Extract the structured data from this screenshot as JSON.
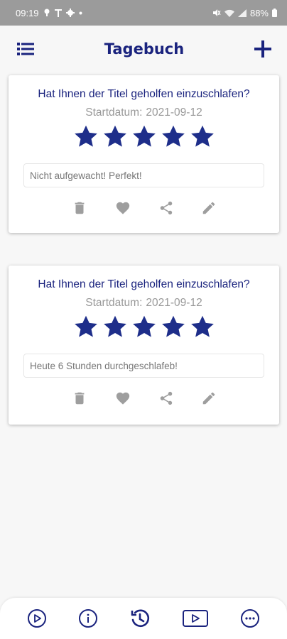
{
  "status_bar": {
    "time": "09:19",
    "battery": "88%",
    "left_icons": [
      "notification-dot-icon",
      "t-icon",
      "gear-icon",
      "dot-icon"
    ],
    "right_icons": [
      "mute-icon",
      "wifi-icon",
      "signal-icon",
      "battery-icon"
    ]
  },
  "header": {
    "title": "Tagebuch",
    "menu_icon": "list-icon",
    "add_icon": "plus-icon"
  },
  "entries": [
    {
      "question": "Hat Ihnen der Titel geholfen einzuschlafen?",
      "date_label": "Startdatum:",
      "date_value": "2021-09-12",
      "rating": 5,
      "rating_max": 5,
      "note": "Nicht aufgewacht! Perfekt!"
    },
    {
      "question": "Hat Ihnen der Titel geholfen einzuschlafen?",
      "date_label": "Startdatum:",
      "date_value": "2021-09-12",
      "rating": 5,
      "rating_max": 5,
      "note": "Heute 6 Stunden durchgeschlafeb!"
    }
  ],
  "card_actions": [
    "trash-icon",
    "heart-icon",
    "share-icon",
    "pencil-icon"
  ],
  "bottom_nav": {
    "items": [
      "play-icon",
      "info-icon",
      "history-icon",
      "video-icon",
      "more-icon"
    ],
    "active": "history-icon"
  },
  "colors": {
    "primary": "#1a237e",
    "star": "#1e2e8a",
    "action_icon": "#9e9e9e",
    "status_bar": "#9b9b9b",
    "background": "#f7f7f7"
  }
}
